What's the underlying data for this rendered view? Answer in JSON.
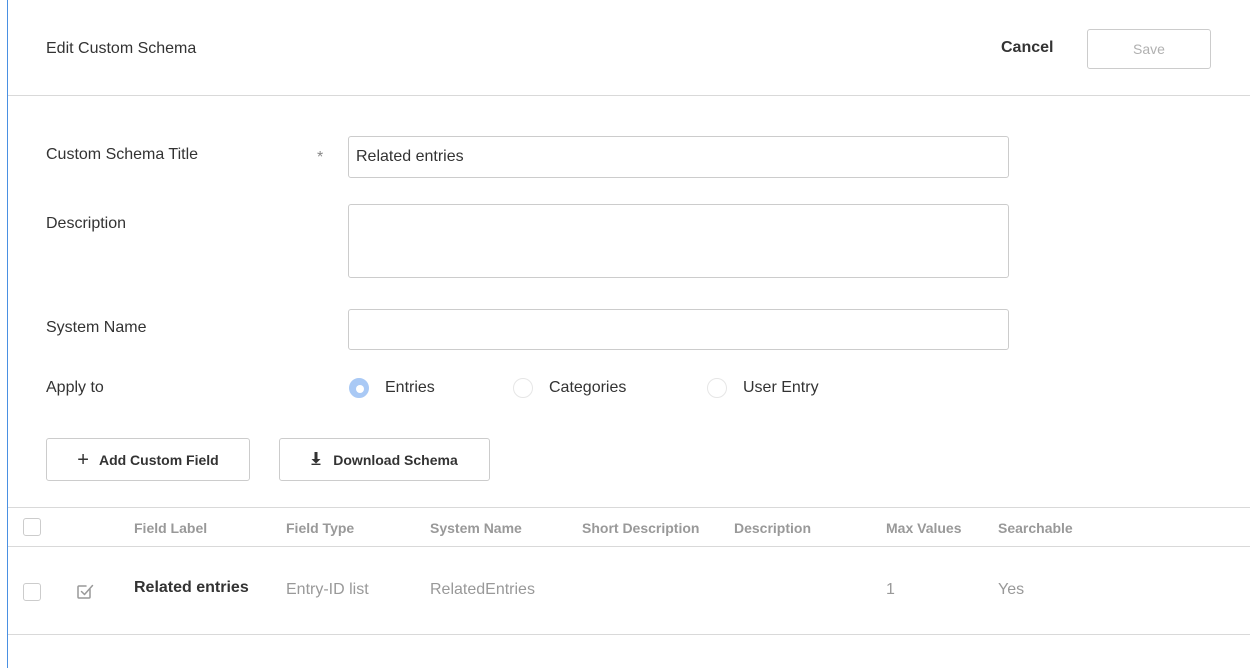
{
  "header": {
    "title": "Edit Custom Schema",
    "cancel_label": "Cancel",
    "save_label": "Save"
  },
  "form": {
    "title_label": "Custom Schema Title",
    "required_mark": "*",
    "title_value": "Related entries",
    "description_label": "Description",
    "description_value": "",
    "system_name_label": "System Name",
    "system_name_value": "",
    "apply_to_label": "Apply to",
    "apply_to_options": [
      "Entries",
      "Categories",
      "User Entry"
    ],
    "apply_to_selected": "Entries"
  },
  "actions": {
    "add_field_label": "Add Custom Field",
    "add_field_icon": "plus-icon",
    "download_label": "Download Schema",
    "download_icon": "download-arrow-icon"
  },
  "table": {
    "headers": [
      "Field Label",
      "Field Type",
      "System Name",
      "Short Description",
      "Description",
      "Max Values",
      "Searchable"
    ],
    "rows": [
      {
        "field_label": "Related entries",
        "field_type": "Entry-ID list",
        "system_name": "RelatedEntries",
        "short_description": "",
        "description": "",
        "max_values": "1",
        "searchable": "Yes",
        "row_icon": "edit-check-icon"
      }
    ]
  },
  "colors": {
    "accent": "#4a90e2",
    "radio_selected": "#a9c9f5",
    "border": "#cccccc",
    "muted_text": "#999999",
    "text": "#333333"
  }
}
